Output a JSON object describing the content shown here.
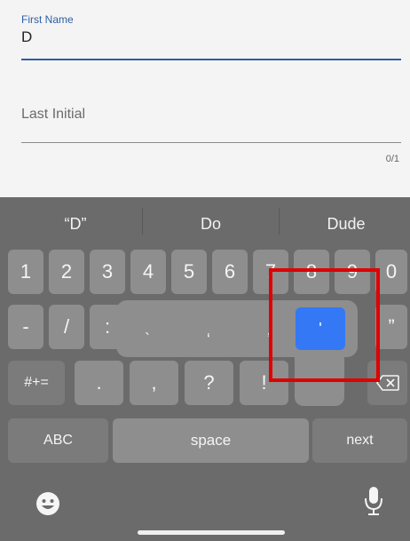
{
  "form": {
    "first_name": {
      "label": "First Name",
      "value": "D"
    },
    "last_initial": {
      "placeholder": "Last Initial",
      "counter": "0/1"
    }
  },
  "keyboard": {
    "suggestions": [
      "“D”",
      "Do",
      "Dude"
    ],
    "row1": [
      "1",
      "2",
      "3",
      "4",
      "5",
      "6",
      "7",
      "8",
      "9",
      "0"
    ],
    "row2": [
      "-",
      "/",
      ":",
      "”"
    ],
    "row3": [
      ".",
      ",",
      "?",
      "!"
    ],
    "toggle_label": "#+=",
    "abc_label": "ABC",
    "space_label": "space",
    "next_label": "next",
    "accent_popup": {
      "options": [
        "`",
        "‘",
        "’",
        "'"
      ],
      "selected": "'"
    },
    "icons": {
      "emoji": "smiley-face-icon",
      "mic": "microphone-icon",
      "delete": "backspace-icon"
    }
  }
}
